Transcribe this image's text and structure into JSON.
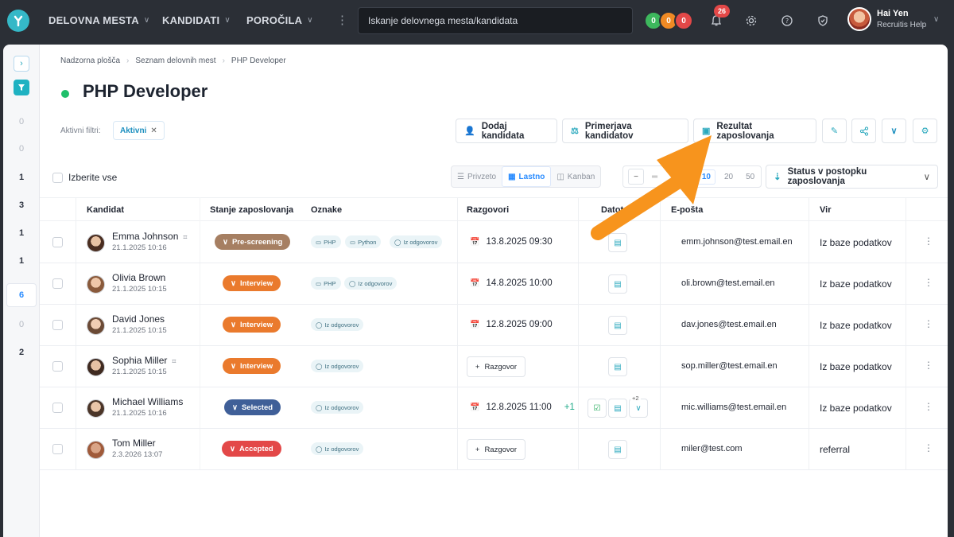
{
  "topbar": {
    "nav": [
      {
        "label": "DELOVNA MESTA"
      },
      {
        "label": "KANDIDATI"
      },
      {
        "label": "POROČILA"
      }
    ],
    "search_placeholder": "Iskanje delovnega mesta/kandidata",
    "status_circles": [
      {
        "value": "0",
        "color": "#3db85d"
      },
      {
        "value": "0",
        "color": "#f08a24"
      },
      {
        "value": "0",
        "color": "#e34848"
      }
    ],
    "notifications_count": "26",
    "user": {
      "name": "Hai Yen",
      "organization": "Recruitis Help"
    }
  },
  "rail": {
    "counts": [
      "0",
      "0",
      "1",
      "3",
      "1",
      "1",
      "6",
      "0",
      "2"
    ]
  },
  "breadcrumb": [
    "Nadzorna plošča",
    "Seznam delovnih mest",
    "PHP Developer"
  ],
  "page_title": "PHP Developer",
  "filters": {
    "label": "Aktivni filtri:",
    "chip": "Aktivni"
  },
  "actions": {
    "add_candidate": "Dodaj kandidata",
    "compare": "Primerjava kandidatov",
    "result": "Rezultat zaposlovanja"
  },
  "toolbar": {
    "select_all": "Izberite vse",
    "views": [
      "Privzeto",
      "Lastno",
      "Kanban"
    ],
    "active_view": "Lastno",
    "page_sizes": [
      "10",
      "20",
      "50"
    ],
    "active_page_size": "10",
    "sort": "Status v postopku zaposlovanja"
  },
  "table": {
    "headers": [
      "Kandidat",
      "Stanje zaposlovanja",
      "Oznake",
      "Razgovori",
      "Datoteke",
      "E-pošta",
      "Vir"
    ],
    "rows": [
      {
        "name": "Emma Johnson",
        "date": "21.1.2025 10:16",
        "status": "Pre-screening",
        "status_color": "#a67f62",
        "tags": [
          "PHP",
          "Python",
          "Iz odgovorov"
        ],
        "interview": "13.8.2025 09:30",
        "email": "emm.johnson@test.email.en",
        "source": "Iz baze podatkov"
      },
      {
        "name": "Olivia Brown",
        "date": "21.1.2025 10:15",
        "status": "Interview",
        "status_color": "#ea7a2d",
        "tags": [
          "PHP",
          "Iz odgovorov"
        ],
        "interview": "14.8.2025 10:00",
        "email": "oli.brown@test.email.en",
        "source": "Iz baze podatkov"
      },
      {
        "name": "David Jones",
        "date": "21.1.2025 10:15",
        "status": "Interview",
        "status_color": "#ea7a2d",
        "tags": [
          "Iz odgovorov"
        ],
        "interview": "12.8.2025 09:00",
        "email": "dav.jones@test.email.en",
        "source": "Iz baze podatkov"
      },
      {
        "name": "Sophia Miller",
        "date": "21.1.2025 10:15",
        "status": "Interview",
        "status_color": "#ea7a2d",
        "tags": [
          "Iz odgovorov"
        ],
        "interview_button": "Razgovor",
        "email": "sop.miller@test.email.en",
        "source": "Iz baze podatkov"
      },
      {
        "name": "Michael Williams",
        "date": "21.1.2025 10:16",
        "status": "Selected",
        "status_color": "#3f5f98",
        "tags": [
          "Iz odgovorov"
        ],
        "interview": "12.8.2025 11:00",
        "interview_extra": "+1",
        "files_extra": "+2",
        "email": "mic.williams@test.email.en",
        "source": "Iz baze podatkov"
      },
      {
        "name": "Tom Miller",
        "date": "2.3.2026 13:07",
        "status": "Accepted",
        "status_color": "#e34848",
        "tags": [
          "Iz odgovorov"
        ],
        "interview_button": "Razgovor",
        "email": "miler@test.com",
        "source": "referral"
      }
    ]
  },
  "annotation_color": "#f7941d"
}
